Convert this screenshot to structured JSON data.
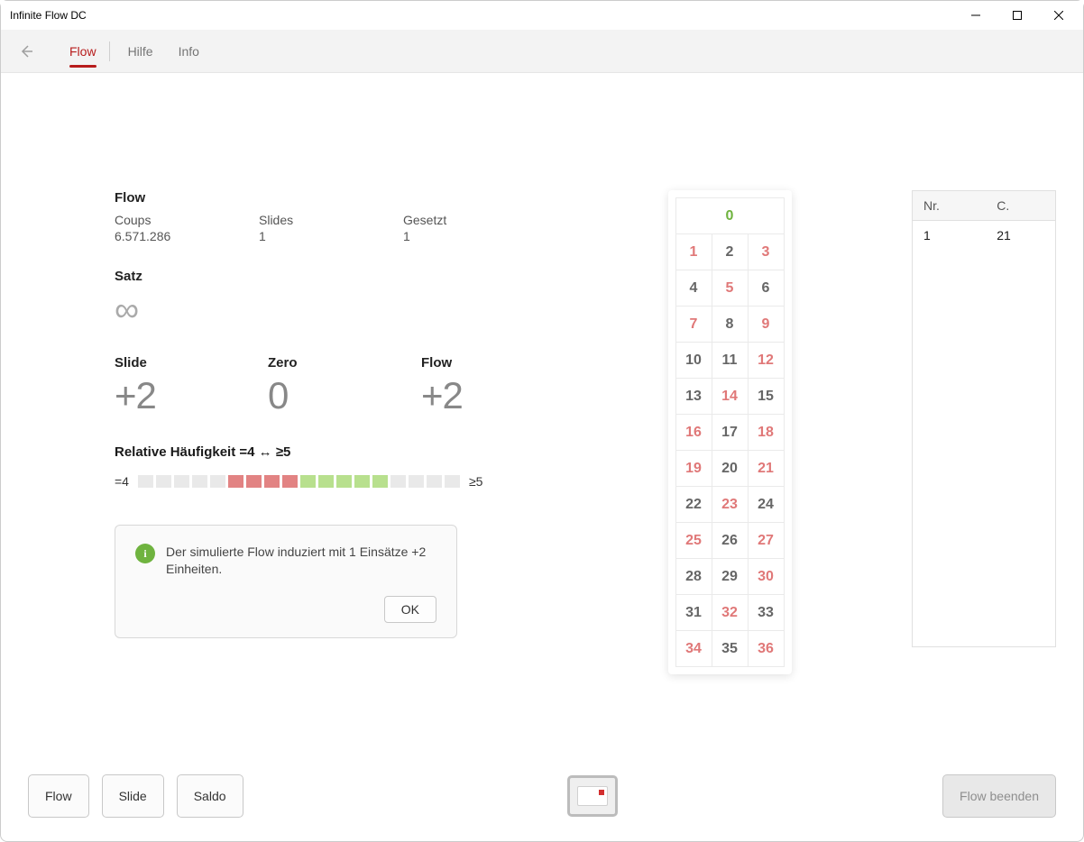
{
  "window": {
    "title": "Infinite Flow DC"
  },
  "nav": {
    "tabs": [
      "Flow",
      "Hilfe",
      "Info"
    ],
    "active": 0
  },
  "flow_section": {
    "title": "Flow",
    "coups_label": "Coups",
    "coups_value": "6.571.286",
    "slides_label": "Slides",
    "slides_value": "1",
    "gesetzt_label": "Gesetzt",
    "gesetzt_value": "1"
  },
  "satz_section": {
    "title": "Satz",
    "symbol": "∞"
  },
  "metrics": {
    "slide_label": "Slide",
    "slide_value": "+2",
    "zero_label": "Zero",
    "zero_value": "0",
    "flow_label": "Flow",
    "flow_value": "+2"
  },
  "freq": {
    "title": "Relative Häufigkeit =4 ↔ ≥5",
    "left_label": "=4",
    "right_label": "≥5",
    "cells": [
      "e",
      "e",
      "e",
      "e",
      "e",
      "n",
      "n",
      "n",
      "n",
      "p",
      "p",
      "p",
      "p",
      "p",
      "e",
      "e",
      "e",
      "e"
    ]
  },
  "dialog": {
    "text": "Der simulierte Flow induziert mit 1 Einsätze +2 Einheiten.",
    "ok": "OK",
    "icon_letter": "i"
  },
  "board": {
    "zero": "0",
    "cells": [
      {
        "n": "1",
        "c": "red"
      },
      {
        "n": "2",
        "c": ""
      },
      {
        "n": "3",
        "c": "red"
      },
      {
        "n": "4",
        "c": ""
      },
      {
        "n": "5",
        "c": "red"
      },
      {
        "n": "6",
        "c": ""
      },
      {
        "n": "7",
        "c": "red"
      },
      {
        "n": "8",
        "c": ""
      },
      {
        "n": "9",
        "c": "red"
      },
      {
        "n": "10",
        "c": ""
      },
      {
        "n": "11",
        "c": ""
      },
      {
        "n": "12",
        "c": "red"
      },
      {
        "n": "13",
        "c": ""
      },
      {
        "n": "14",
        "c": "red"
      },
      {
        "n": "15",
        "c": ""
      },
      {
        "n": "16",
        "c": "red"
      },
      {
        "n": "17",
        "c": ""
      },
      {
        "n": "18",
        "c": "red"
      },
      {
        "n": "19",
        "c": "red"
      },
      {
        "n": "20",
        "c": ""
      },
      {
        "n": "21",
        "c": "red"
      },
      {
        "n": "22",
        "c": ""
      },
      {
        "n": "23",
        "c": "red"
      },
      {
        "n": "24",
        "c": ""
      },
      {
        "n": "25",
        "c": "red"
      },
      {
        "n": "26",
        "c": ""
      },
      {
        "n": "27",
        "c": "red"
      },
      {
        "n": "28",
        "c": ""
      },
      {
        "n": "29",
        "c": ""
      },
      {
        "n": "30",
        "c": "red"
      },
      {
        "n": "31",
        "c": ""
      },
      {
        "n": "32",
        "c": "red"
      },
      {
        "n": "33",
        "c": ""
      },
      {
        "n": "34",
        "c": "red"
      },
      {
        "n": "35",
        "c": ""
      },
      {
        "n": "36",
        "c": "red"
      }
    ]
  },
  "history": {
    "col_nr": "Nr.",
    "col_c": "C.",
    "rows": [
      {
        "nr": "1",
        "c": "21"
      }
    ]
  },
  "bottom": {
    "flow": "Flow",
    "slide": "Slide",
    "saldo": "Saldo",
    "end": "Flow beenden"
  }
}
